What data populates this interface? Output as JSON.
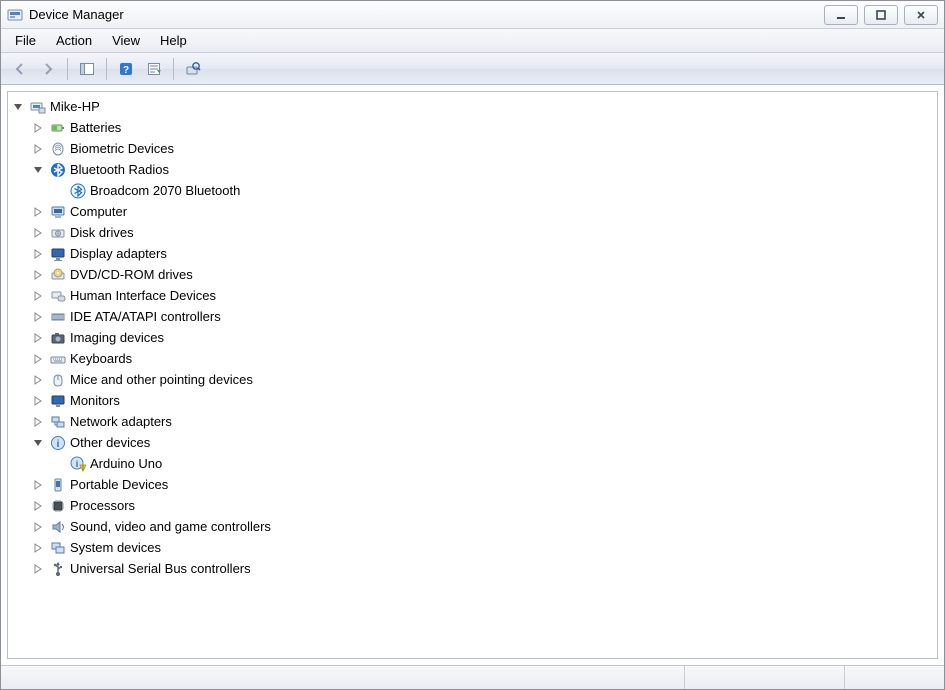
{
  "window": {
    "title": "Device Manager"
  },
  "menu": {
    "file": "File",
    "action": "Action",
    "view": "View",
    "help": "Help"
  },
  "tree": {
    "root": "Mike-HP",
    "batteries": "Batteries",
    "biometric": "Biometric Devices",
    "bluetooth": "Bluetooth Radios",
    "bluetooth_child": "Broadcom 2070 Bluetooth",
    "computer": "Computer",
    "disk": "Disk drives",
    "display": "Display adapters",
    "dvd": "DVD/CD-ROM drives",
    "hid": "Human Interface Devices",
    "ide": "IDE ATA/ATAPI controllers",
    "imaging": "Imaging devices",
    "keyboards": "Keyboards",
    "mice": "Mice and other pointing devices",
    "monitors": "Monitors",
    "network": "Network adapters",
    "other": "Other devices",
    "other_child": "Arduino Uno",
    "portable": "Portable Devices",
    "processors": "Processors",
    "sound": "Sound, video and game controllers",
    "system": "System devices",
    "usb": "Universal Serial Bus controllers"
  }
}
